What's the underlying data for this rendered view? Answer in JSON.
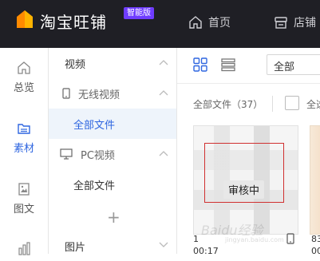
{
  "header": {
    "brand": "淘宝旺铺",
    "badge": "智能版",
    "nav": [
      {
        "label": "首页",
        "icon": "home-icon"
      },
      {
        "label": "店铺",
        "icon": "store-icon"
      }
    ]
  },
  "rail": [
    {
      "label": "总览",
      "icon": "home-icon"
    },
    {
      "label": "素材",
      "icon": "folder-icon",
      "active": true
    },
    {
      "label": "图文",
      "icon": "image-doc-icon"
    },
    {
      "icon": "bar-chart-icon"
    }
  ],
  "panel": {
    "video": "视频",
    "wireless_video": "无线视频",
    "all_files_1": "全部文件",
    "pc_video": "PC视频",
    "all_files_2": "全部文件",
    "add": "+",
    "images": "图片"
  },
  "main": {
    "filter_value": "全部",
    "count_text": "全部文件（37）",
    "select_all": "全选",
    "card": {
      "status": "审核中",
      "name": "1",
      "duration": "00:17"
    },
    "card2": {
      "name": "83",
      "duration": "00:"
    },
    "watermark": "Baidu经验",
    "watermark_url": "jingyan.baidu.com"
  },
  "colors": {
    "topbar": "#1f1f25",
    "badge": "#6f3cff",
    "accent": "#2f66e0",
    "review_border": "#d03030"
  }
}
